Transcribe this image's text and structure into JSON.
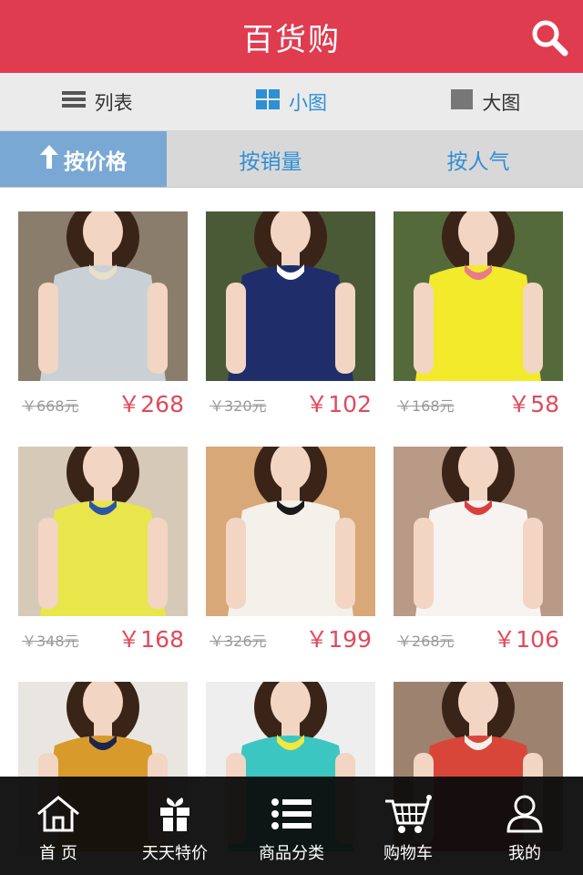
{
  "header": {
    "title": "百货购",
    "search_icon": "search-icon"
  },
  "view_switch": {
    "tabs": [
      {
        "label": "列表",
        "icon": "list-icon",
        "active": false
      },
      {
        "label": "小图",
        "icon": "small-grid-icon",
        "active": true
      },
      {
        "label": "大图",
        "icon": "large-image-icon",
        "active": false
      }
    ]
  },
  "sort": {
    "tabs": [
      {
        "label": "按价格",
        "icon": "arrow-up-icon",
        "active": true
      },
      {
        "label": "按销量",
        "active": false
      },
      {
        "label": "按人气",
        "active": false
      }
    ]
  },
  "products": [
    {
      "old_price": "￥668元",
      "price": "￥268",
      "colors": {
        "bg": "#8a7d6c",
        "garment": "#c9d1d6",
        "accent": "#e8e0c8"
      }
    },
    {
      "old_price": "￥320元",
      "price": "￥102",
      "colors": {
        "bg": "#4a5a36",
        "garment": "#1f2e6b",
        "accent": "#ffffff"
      }
    },
    {
      "old_price": "￥168元",
      "price": "￥58",
      "colors": {
        "bg": "#556a3a",
        "garment": "#f2ea2a",
        "accent": "#e87a8a"
      }
    },
    {
      "old_price": "￥348元",
      "price": "￥168",
      "colors": {
        "bg": "#d7c9b8",
        "garment": "#e8e64a",
        "accent": "#2b55a8"
      }
    },
    {
      "old_price": "￥326元",
      "price": "￥199",
      "colors": {
        "bg": "#d8a878",
        "garment": "#f4f1ea",
        "accent": "#1a1a1a"
      }
    },
    {
      "old_price": "￥268元",
      "price": "￥106",
      "colors": {
        "bg": "#b89a86",
        "garment": "#f6f3f0",
        "accent": "#d84040"
      }
    },
    {
      "old_price": "",
      "price": "",
      "colors": {
        "bg": "#e9e6e1",
        "garment": "#d89a2a",
        "accent": "#1c2450"
      }
    },
    {
      "old_price": "",
      "price": "",
      "colors": {
        "bg": "#eeeeee",
        "garment": "#3cc6c2",
        "accent": "#f3e93a"
      }
    },
    {
      "old_price": "",
      "price": "",
      "colors": {
        "bg": "#9d8270",
        "garment": "#d8463a",
        "accent": "#f4f0ea"
      }
    }
  ],
  "tabbar": {
    "items": [
      {
        "label": "首 页",
        "icon": "home-icon"
      },
      {
        "label": "天天特价",
        "icon": "gift-icon"
      },
      {
        "label": "商品分类",
        "icon": "category-list-icon"
      },
      {
        "label": "购物车",
        "icon": "cart-icon"
      },
      {
        "label": "我的",
        "icon": "user-icon"
      }
    ]
  }
}
